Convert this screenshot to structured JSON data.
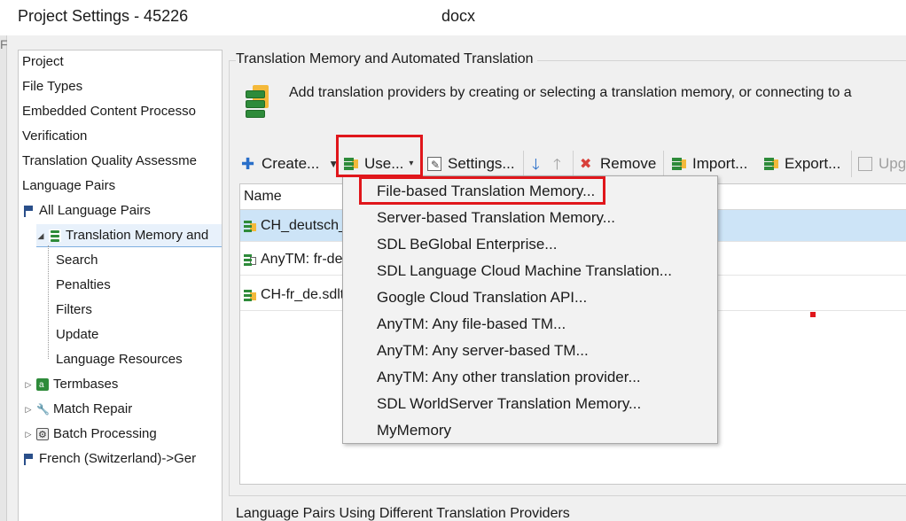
{
  "window": {
    "title": "Project Settings - 45226",
    "title_suffix": "docx"
  },
  "left_edge_char": "F",
  "nav": {
    "items": [
      {
        "label": "Project"
      },
      {
        "label": "File Types"
      },
      {
        "label": "Embedded Content Processo"
      },
      {
        "label": "Verification"
      },
      {
        "label": "Translation Quality Assessme"
      },
      {
        "label": "Language Pairs"
      },
      {
        "label": "All Language Pairs"
      },
      {
        "label": "Translation Memory and"
      },
      {
        "label": "Search"
      },
      {
        "label": "Penalties"
      },
      {
        "label": "Filters"
      },
      {
        "label": "Update"
      },
      {
        "label": "Language Resources"
      },
      {
        "label": "Termbases"
      },
      {
        "label": "Match Repair"
      },
      {
        "label": "Batch Processing"
      },
      {
        "label": "French (Switzerland)->Ger"
      }
    ]
  },
  "main": {
    "group_title": "Translation Memory and Automated Translation",
    "description": "Add translation providers by creating or selecting a translation memory, or connecting to a",
    "bottom_group_title": "Language Pairs Using Different Translation Providers",
    "list_header": "Name",
    "rows": [
      {
        "name": "CH_deutsch_"
      },
      {
        "name": "AnyTM: fr-de"
      },
      {
        "name": "CH-fr_de.sdlt"
      }
    ]
  },
  "toolbar": {
    "create": "Create...",
    "use": "Use...",
    "settings": "Settings...",
    "remove": "Remove",
    "import": "Import...",
    "export": "Export...",
    "upgrade": "Upg"
  },
  "use_menu": {
    "items": [
      {
        "label": "File-based Translation Memory..."
      },
      {
        "label": "Server-based Translation Memory..."
      },
      {
        "label": "SDL BeGlobal Enterprise..."
      },
      {
        "label": "SDL Language Cloud Machine Translation..."
      },
      {
        "label": "Google Cloud Translation API..."
      },
      {
        "label": "AnyTM: Any file-based TM..."
      },
      {
        "label": "AnyTM: Any server-based TM..."
      },
      {
        "label": "AnyTM: Any other translation provider..."
      },
      {
        "label": "SDL WorldServer Translation Memory..."
      },
      {
        "label": "MyMemory"
      }
    ]
  },
  "colors": {
    "annotation_red": "#e0161b",
    "selection_blue": "#cde4f7",
    "accent_green": "#2e8b3a"
  }
}
